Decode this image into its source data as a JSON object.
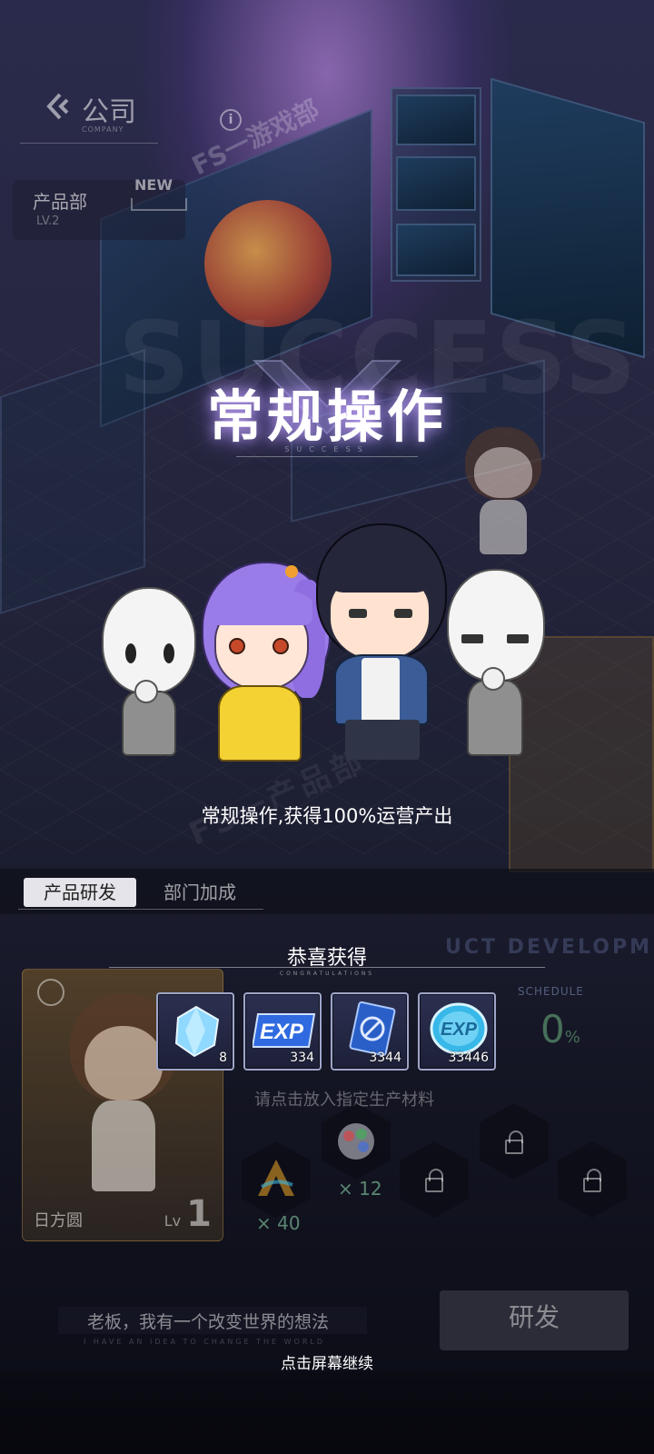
{
  "header": {
    "company_title": "公司",
    "company_sub": "COMPANY",
    "info_icon": "info-icon",
    "department_sign": "FS一游戏部",
    "department_name": "产品部",
    "department_level": "LV.2",
    "new_badge": "NEW"
  },
  "result": {
    "title": "常规操作",
    "title_sub": "SUCCESS",
    "background_word": "SUCCESS",
    "description": "常规操作,获得100%运营产出"
  },
  "tabs": [
    {
      "label": "产品研发",
      "active": true
    },
    {
      "label": "部门加成",
      "active": false
    }
  ],
  "rewards": {
    "title": "恭喜获得",
    "subtitle": "CONGRATULATIONS",
    "items": [
      {
        "icon": "blue-crystal-icon",
        "qty": "8"
      },
      {
        "icon": "exp-book-icon",
        "qty": "334"
      },
      {
        "icon": "blue-card-icon",
        "qty": "3344"
      },
      {
        "icon": "exp-coin-icon",
        "qty": "33446"
      }
    ]
  },
  "background_panel": {
    "character_name": "日方圆",
    "character_level_prefix": "Lv",
    "character_level": "1",
    "dev_label": "UCT DEVELOPMEN",
    "schedule_label": "SCHEDULE",
    "schedule_value": "0",
    "schedule_unit": "%",
    "hint": "请点击放入指定生产材料",
    "materials": [
      {
        "icon": "a-logo-material-icon",
        "count": "× 40"
      },
      {
        "icon": "color-palette-icon",
        "count": "× 12"
      }
    ],
    "quote": "老板，我有一个改变世界的想法",
    "quote_sub": "I HAVE AN IDEA TO CHANGE THE WORLD",
    "dev_button": "研发"
  },
  "footer": {
    "tap_continue": "点击屏幕继续"
  },
  "colors": {
    "glow": "#c896ff",
    "reward_border": "#9ea6c8",
    "tab_active_bg": "#e4e4ea"
  }
}
